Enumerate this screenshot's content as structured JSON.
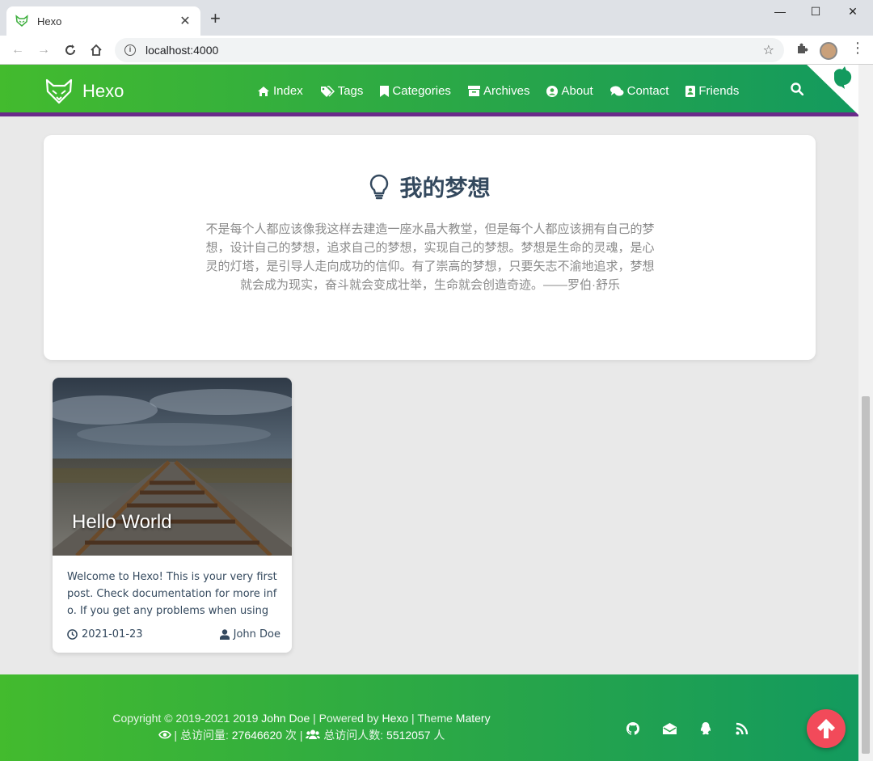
{
  "browser": {
    "tab_title": "Hexo",
    "tab_close": "✕",
    "new_tab": "+",
    "url": "localhost:4000",
    "min": "—",
    "max": "☐",
    "close": "✕"
  },
  "site": {
    "logo_text": "Hexo",
    "nav": [
      {
        "label": "Index",
        "icon": "home-icon"
      },
      {
        "label": "Tags",
        "icon": "tags-icon"
      },
      {
        "label": "Categories",
        "icon": "bookmark-icon"
      },
      {
        "label": "Archives",
        "icon": "archive-icon"
      },
      {
        "label": "About",
        "icon": "user-circle-icon"
      },
      {
        "label": "Contact",
        "icon": "comments-icon"
      },
      {
        "label": "Friends",
        "icon": "address-book-icon"
      }
    ],
    "accent": "#42b82f",
    "border": "#6a2a8a"
  },
  "dream": {
    "title": "我的梦想",
    "text": "不是每个人都应该像我这样去建造一座水晶大教堂，但是每个人都应该拥有自己的梦想，设计自己的梦想，追求自己的梦想，实现自己的梦想。梦想是生命的灵魂，是心灵的灯塔，是引导人走向成功的信仰。有了崇高的梦想，只要矢志不渝地追求，梦想就会成为现实，奋斗就会变成壮举，生命就会创造奇迹。——罗伯·舒乐"
  },
  "post": {
    "title": "Hello World",
    "excerpt": "Welcome to Hexo! This is your very first post. Check documentation for more info. If you get any problems when using H…",
    "date": "2021-01-23",
    "author": "John Doe"
  },
  "footer": {
    "copy_prefix": "Copyright © 2019-2021 2019 ",
    "author": "John Doe",
    "powered": " | Powered by ",
    "hexo": "Hexo",
    "theme_label": " | Theme ",
    "theme": "Matery",
    "views": " | 总访问量: ",
    "views_num": "27646620",
    "views_unit": " 次 | ",
    "visitors": " 总访问人数: ",
    "visitors_num": "5512057",
    "visitors_unit": " 人",
    "back_top_color": "#f24a5a"
  }
}
